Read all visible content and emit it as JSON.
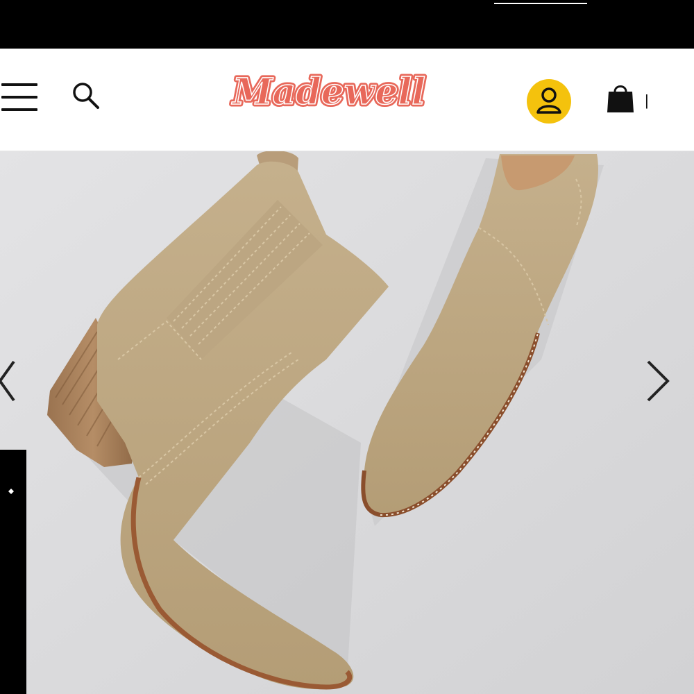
{
  "promo": {
    "text": "",
    "link_text": ""
  },
  "header": {
    "logo_text": "Madewell",
    "menu_icon": "hamburger-menu-icon",
    "search_icon": "search-icon",
    "account_icon": "user-icon",
    "bag_icon": "shopping-bag-icon",
    "bag_count": "|",
    "accent_color": "#f4c20d",
    "logo_color": "#e8685a"
  },
  "gallery": {
    "product": "tan suede western ankle boots with stacked wooden heel",
    "prev_icon": "chevron-left-icon",
    "next_icon": "chevron-right-icon",
    "background_color": "#d8d8da"
  },
  "side_tab": {
    "text": "",
    "icon": "sparkle-icon"
  }
}
